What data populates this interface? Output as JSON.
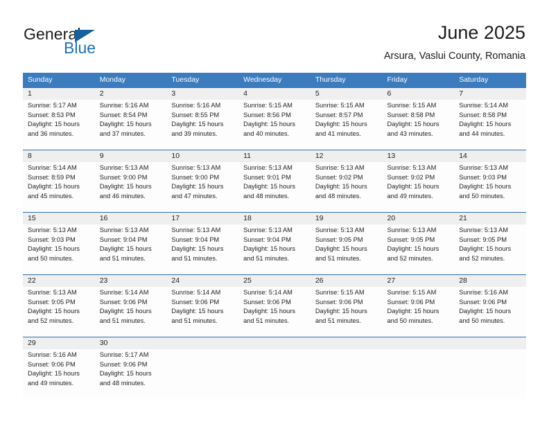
{
  "brand": {
    "name_part1": "General",
    "name_part2": "Blue",
    "mark": "triangle-logo",
    "accent_color": "#1d71b8"
  },
  "header": {
    "title": "June 2025",
    "subtitle": "Arsura, Vaslui County, Romania"
  },
  "theme": {
    "header_row_bg": "#3c7cbe",
    "date_band_bg": "#efefef",
    "week_divider": "#2c6cb0",
    "text": "#222222"
  },
  "weekdays": [
    {
      "label": "Sunday"
    },
    {
      "label": "Monday"
    },
    {
      "label": "Tuesday"
    },
    {
      "label": "Wednesday"
    },
    {
      "label": "Thursday"
    },
    {
      "label": "Friday"
    },
    {
      "label": "Saturday"
    }
  ],
  "weeks": [
    {
      "dates": [
        "1",
        "2",
        "3",
        "4",
        "5",
        "6",
        "7"
      ],
      "days": [
        {
          "sunrise": "Sunrise: 5:17 AM",
          "sunset": "Sunset: 8:53 PM",
          "daylight1": "Daylight: 15 hours",
          "daylight2": "and 36 minutes."
        },
        {
          "sunrise": "Sunrise: 5:16 AM",
          "sunset": "Sunset: 8:54 PM",
          "daylight1": "Daylight: 15 hours",
          "daylight2": "and 37 minutes."
        },
        {
          "sunrise": "Sunrise: 5:16 AM",
          "sunset": "Sunset: 8:55 PM",
          "daylight1": "Daylight: 15 hours",
          "daylight2": "and 39 minutes."
        },
        {
          "sunrise": "Sunrise: 5:15 AM",
          "sunset": "Sunset: 8:56 PM",
          "daylight1": "Daylight: 15 hours",
          "daylight2": "and 40 minutes."
        },
        {
          "sunrise": "Sunrise: 5:15 AM",
          "sunset": "Sunset: 8:57 PM",
          "daylight1": "Daylight: 15 hours",
          "daylight2": "and 41 minutes."
        },
        {
          "sunrise": "Sunrise: 5:15 AM",
          "sunset": "Sunset: 8:58 PM",
          "daylight1": "Daylight: 15 hours",
          "daylight2": "and 43 minutes."
        },
        {
          "sunrise": "Sunrise: 5:14 AM",
          "sunset": "Sunset: 8:58 PM",
          "daylight1": "Daylight: 15 hours",
          "daylight2": "and 44 minutes."
        }
      ]
    },
    {
      "dates": [
        "8",
        "9",
        "10",
        "11",
        "12",
        "13",
        "14"
      ],
      "days": [
        {
          "sunrise": "Sunrise: 5:14 AM",
          "sunset": "Sunset: 8:59 PM",
          "daylight1": "Daylight: 15 hours",
          "daylight2": "and 45 minutes."
        },
        {
          "sunrise": "Sunrise: 5:13 AM",
          "sunset": "Sunset: 9:00 PM",
          "daylight1": "Daylight: 15 hours",
          "daylight2": "and 46 minutes."
        },
        {
          "sunrise": "Sunrise: 5:13 AM",
          "sunset": "Sunset: 9:00 PM",
          "daylight1": "Daylight: 15 hours",
          "daylight2": "and 47 minutes."
        },
        {
          "sunrise": "Sunrise: 5:13 AM",
          "sunset": "Sunset: 9:01 PM",
          "daylight1": "Daylight: 15 hours",
          "daylight2": "and 48 minutes."
        },
        {
          "sunrise": "Sunrise: 5:13 AM",
          "sunset": "Sunset: 9:02 PM",
          "daylight1": "Daylight: 15 hours",
          "daylight2": "and 48 minutes."
        },
        {
          "sunrise": "Sunrise: 5:13 AM",
          "sunset": "Sunset: 9:02 PM",
          "daylight1": "Daylight: 15 hours",
          "daylight2": "and 49 minutes."
        },
        {
          "sunrise": "Sunrise: 5:13 AM",
          "sunset": "Sunset: 9:03 PM",
          "daylight1": "Daylight: 15 hours",
          "daylight2": "and 50 minutes."
        }
      ]
    },
    {
      "dates": [
        "15",
        "16",
        "17",
        "18",
        "19",
        "20",
        "21"
      ],
      "days": [
        {
          "sunrise": "Sunrise: 5:13 AM",
          "sunset": "Sunset: 9:03 PM",
          "daylight1": "Daylight: 15 hours",
          "daylight2": "and 50 minutes."
        },
        {
          "sunrise": "Sunrise: 5:13 AM",
          "sunset": "Sunset: 9:04 PM",
          "daylight1": "Daylight: 15 hours",
          "daylight2": "and 51 minutes."
        },
        {
          "sunrise": "Sunrise: 5:13 AM",
          "sunset": "Sunset: 9:04 PM",
          "daylight1": "Daylight: 15 hours",
          "daylight2": "and 51 minutes."
        },
        {
          "sunrise": "Sunrise: 5:13 AM",
          "sunset": "Sunset: 9:04 PM",
          "daylight1": "Daylight: 15 hours",
          "daylight2": "and 51 minutes."
        },
        {
          "sunrise": "Sunrise: 5:13 AM",
          "sunset": "Sunset: 9:05 PM",
          "daylight1": "Daylight: 15 hours",
          "daylight2": "and 51 minutes."
        },
        {
          "sunrise": "Sunrise: 5:13 AM",
          "sunset": "Sunset: 9:05 PM",
          "daylight1": "Daylight: 15 hours",
          "daylight2": "and 52 minutes."
        },
        {
          "sunrise": "Sunrise: 5:13 AM",
          "sunset": "Sunset: 9:05 PM",
          "daylight1": "Daylight: 15 hours",
          "daylight2": "and 52 minutes."
        }
      ]
    },
    {
      "dates": [
        "22",
        "23",
        "24",
        "25",
        "26",
        "27",
        "28"
      ],
      "days": [
        {
          "sunrise": "Sunrise: 5:13 AM",
          "sunset": "Sunset: 9:05 PM",
          "daylight1": "Daylight: 15 hours",
          "daylight2": "and 52 minutes."
        },
        {
          "sunrise": "Sunrise: 5:14 AM",
          "sunset": "Sunset: 9:06 PM",
          "daylight1": "Daylight: 15 hours",
          "daylight2": "and 51 minutes."
        },
        {
          "sunrise": "Sunrise: 5:14 AM",
          "sunset": "Sunset: 9:06 PM",
          "daylight1": "Daylight: 15 hours",
          "daylight2": "and 51 minutes."
        },
        {
          "sunrise": "Sunrise: 5:14 AM",
          "sunset": "Sunset: 9:06 PM",
          "daylight1": "Daylight: 15 hours",
          "daylight2": "and 51 minutes."
        },
        {
          "sunrise": "Sunrise: 5:15 AM",
          "sunset": "Sunset: 9:06 PM",
          "daylight1": "Daylight: 15 hours",
          "daylight2": "and 51 minutes."
        },
        {
          "sunrise": "Sunrise: 5:15 AM",
          "sunset": "Sunset: 9:06 PM",
          "daylight1": "Daylight: 15 hours",
          "daylight2": "and 50 minutes."
        },
        {
          "sunrise": "Sunrise: 5:16 AM",
          "sunset": "Sunset: 9:06 PM",
          "daylight1": "Daylight: 15 hours",
          "daylight2": "and 50 minutes."
        }
      ]
    },
    {
      "dates": [
        "29",
        "30",
        "",
        "",
        "",
        "",
        ""
      ],
      "days": [
        {
          "sunrise": "Sunrise: 5:16 AM",
          "sunset": "Sunset: 9:06 PM",
          "daylight1": "Daylight: 15 hours",
          "daylight2": "and 49 minutes."
        },
        {
          "sunrise": "Sunrise: 5:17 AM",
          "sunset": "Sunset: 9:06 PM",
          "daylight1": "Daylight: 15 hours",
          "daylight2": "and 48 minutes."
        },
        null,
        null,
        null,
        null,
        null
      ]
    }
  ]
}
